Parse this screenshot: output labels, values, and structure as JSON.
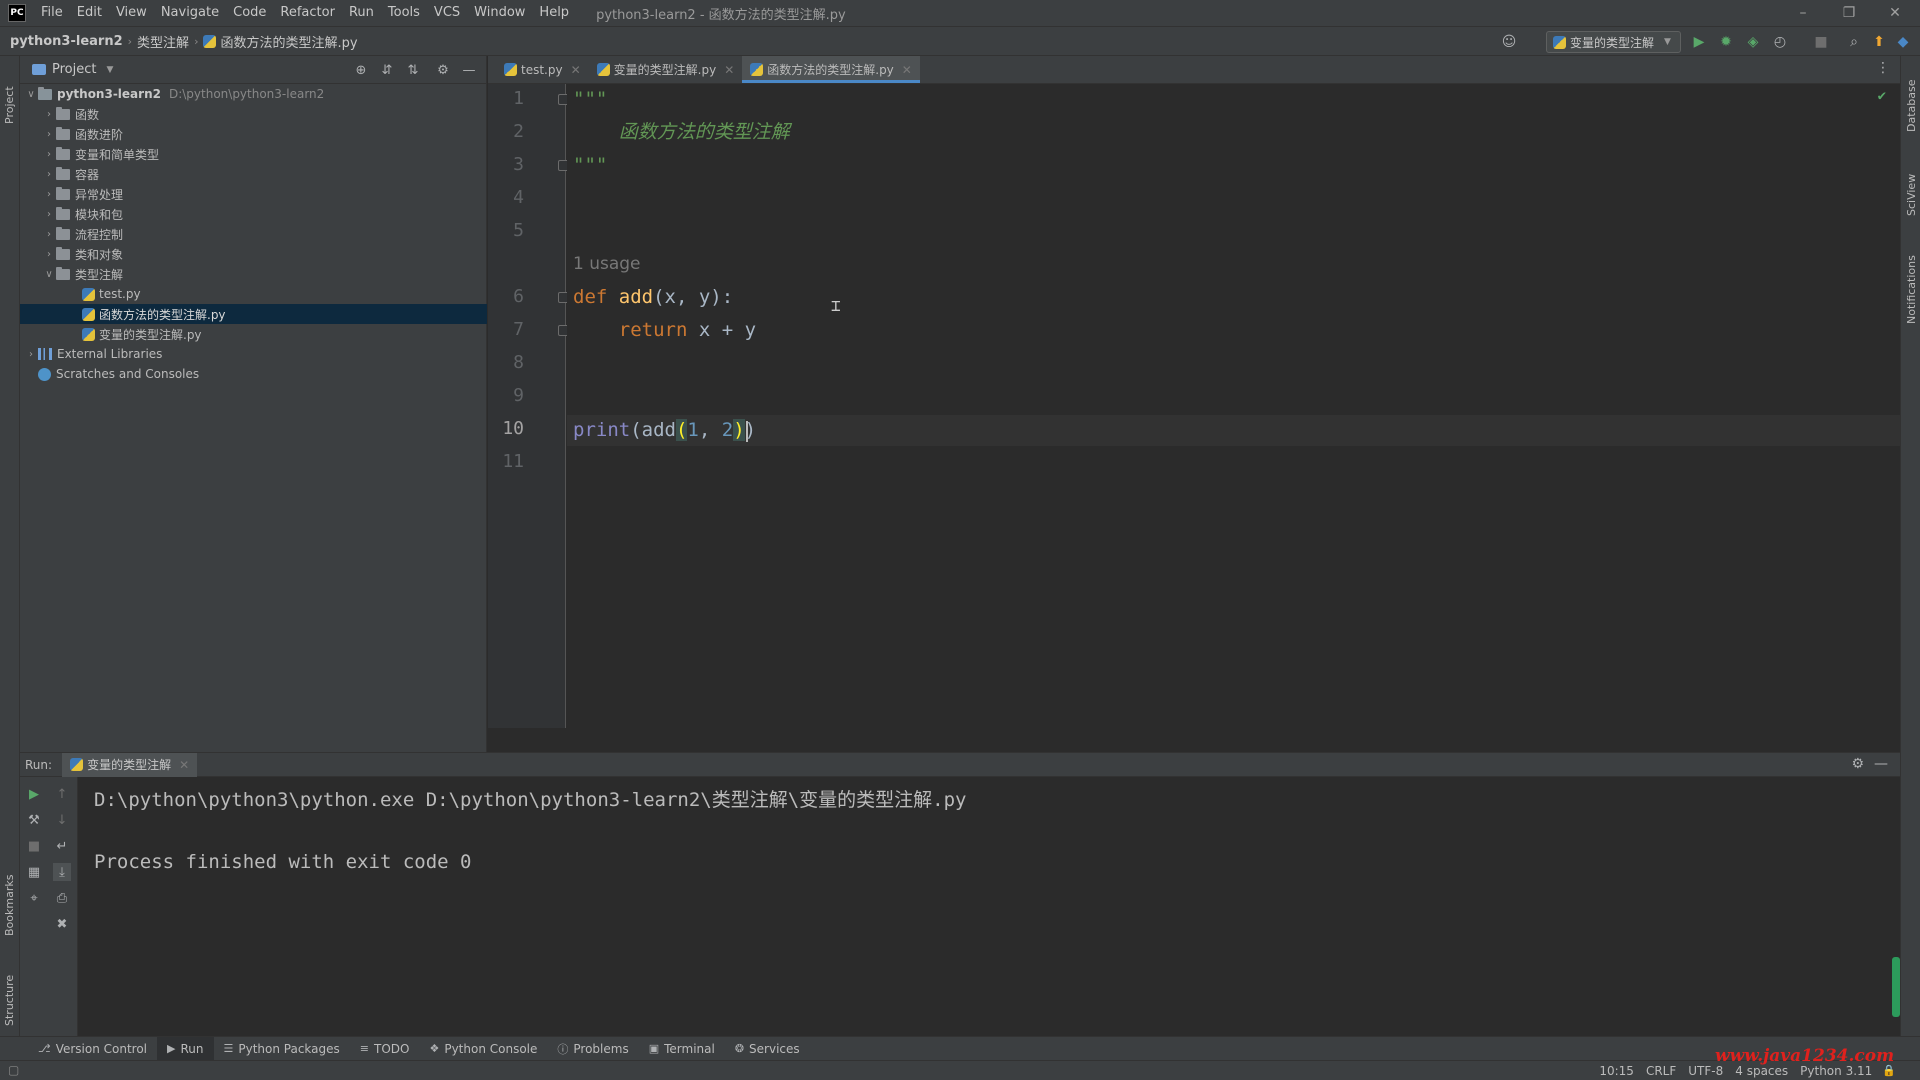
{
  "menu": {
    "logo": "PC",
    "items": [
      "File",
      "Edit",
      "View",
      "Navigate",
      "Code",
      "Refactor",
      "Run",
      "Tools",
      "VCS",
      "Window",
      "Help"
    ],
    "window_title": "python3-learn2 - 函数方法的类型注解.py"
  },
  "breadcrumb": {
    "project": "python3-learn2",
    "folder": "类型注解",
    "file": "函数方法的类型注解.py"
  },
  "run_config": {
    "label": "变量的类型注解"
  },
  "project_panel": {
    "title": "Project",
    "root": {
      "name": "python3-learn2",
      "path": "D:\\python\\python3-learn2"
    },
    "folders": [
      "函数",
      "函数进阶",
      "变量和简单类型",
      "容器",
      "异常处理",
      "模块和包",
      "流程控制",
      "类和对象"
    ],
    "open_folder": "类型注解",
    "files": [
      "test.py",
      "函数方法的类型注解.py",
      "变量的类型注解.py"
    ],
    "external_libraries": "External Libraries",
    "scratches": "Scratches and Consoles"
  },
  "editor": {
    "tabs": [
      "test.py",
      "变量的类型注解.py",
      "函数方法的类型注解.py"
    ],
    "active_tab": "函数方法的类型注解.py",
    "line_numbers": [
      "1",
      "2",
      "3",
      "4",
      "5",
      "6",
      "7",
      "8",
      "9",
      "10",
      "11"
    ],
    "current_line": "10",
    "usage_hint": "1 usage",
    "code": {
      "doc_open": "\"\"\"",
      "doc_text": "    函数方法的类型注解",
      "doc_close": "\"\"\"",
      "def_kw": "def",
      "def_name": "add",
      "def_params": "(x, y):",
      "return_indent": "    ",
      "return_kw": "return",
      "return_expr": " x + y",
      "print_fn": "print",
      "print_open": "(add",
      "brace_open": "(",
      "arg1": "1",
      "comma": ", ",
      "arg2": "2",
      "brace_close": ")",
      "print_close": ")"
    }
  },
  "run_panel": {
    "label": "Run:",
    "tab": "变量的类型注解",
    "command": "D:\\python\\python3\\python.exe D:\\python\\python3-learn2\\类型注解\\变量的类型注解.py",
    "result": "Process finished with exit code 0"
  },
  "side_labels": {
    "project": "Project",
    "bookmarks": "Bookmarks",
    "structure": "Structure",
    "database": "Database",
    "sciview": "SciView",
    "notifications": "Notifications"
  },
  "tool_windows": [
    "Version Control",
    "Run",
    "Python Packages",
    "TODO",
    "Python Console",
    "Problems",
    "Terminal",
    "Services"
  ],
  "status": {
    "position": "10:15",
    "line_sep": "CRLF",
    "encoding": "UTF-8",
    "indent": "4 spaces",
    "interpreter": "Python 3.11"
  },
  "watermark": "www.java1234.com"
}
